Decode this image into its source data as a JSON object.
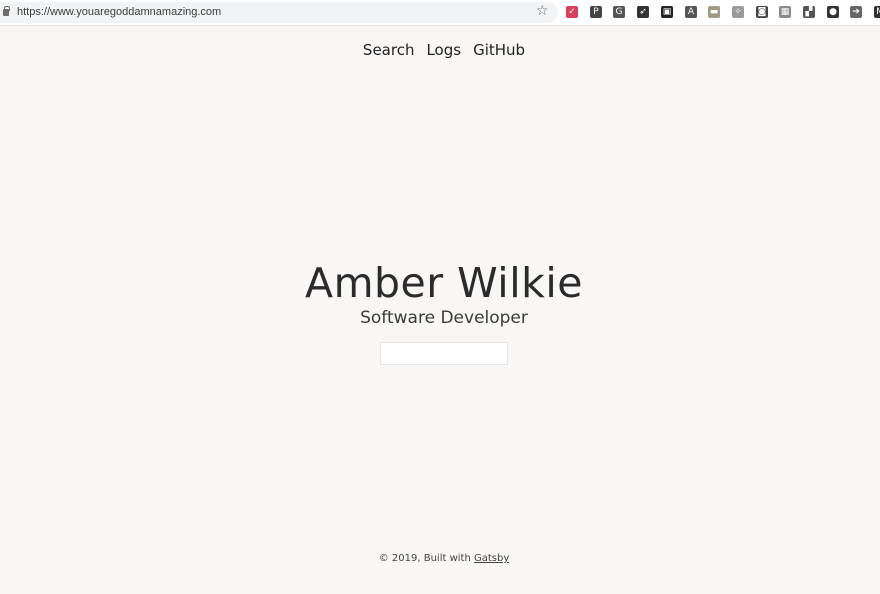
{
  "browser": {
    "url": "https://www.youaregoddamnamazing.com",
    "extensions": [
      {
        "name": "pocket-icon",
        "glyph": "✓",
        "color": "#d9425a"
      },
      {
        "name": "pinterest-icon",
        "glyph": "P",
        "color": "#444444"
      },
      {
        "name": "grammarly-icon",
        "glyph": "G",
        "color": "#555555"
      },
      {
        "name": "rocket-icon",
        "glyph": "➶",
        "color": "#333333"
      },
      {
        "name": "clipper-icon",
        "glyph": "▣",
        "color": "#222222"
      },
      {
        "name": "angular-icon",
        "glyph": "A",
        "color": "#555555"
      },
      {
        "name": "bookmark-manager-icon",
        "glyph": "▬",
        "color": "#a39a86"
      },
      {
        "name": "sparkle-icon",
        "glyph": "✧",
        "color": "#9a9a9a"
      },
      {
        "name": "screenshot-icon",
        "glyph": "◙",
        "color": "#444444"
      },
      {
        "name": "qr-code-icon",
        "glyph": "▦",
        "color": "#8a8a8a"
      },
      {
        "name": "layout-icon",
        "glyph": "▞",
        "color": "#555555"
      },
      {
        "name": "mouse-icon",
        "glyph": "●",
        "color": "#333333"
      },
      {
        "name": "forward-icon",
        "glyph": "➔",
        "color": "#666666"
      },
      {
        "name": "gmail-icon",
        "glyph": "M",
        "color": "#333333"
      }
    ]
  },
  "nav": {
    "items": [
      "Search",
      "Logs",
      "GitHub"
    ]
  },
  "hero": {
    "name": "Amber Wilkie",
    "role": "Software Developer",
    "input_value": ""
  },
  "footer": {
    "text": "© 2019, Built with",
    "link": "Gatsby"
  }
}
